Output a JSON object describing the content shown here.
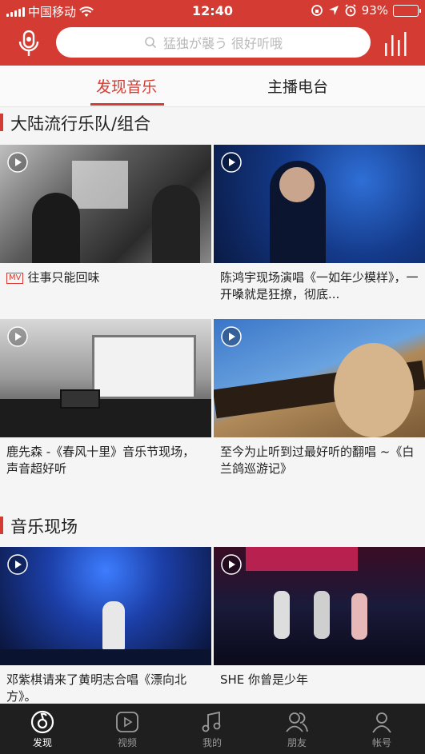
{
  "status_bar": {
    "carrier": "中国移动",
    "time": "12:40",
    "battery": "93%",
    "battery_level": 0.93,
    "icons": [
      "signal-icon",
      "wifi-icon",
      "lock-rotation-icon",
      "location-icon",
      "alarm-icon",
      "battery-icon"
    ]
  },
  "header": {
    "search_placeholder": "猛独が襲う 很好听哦",
    "left_icon": "microphone-icon",
    "right_icon": "equalizer-icon"
  },
  "tabs": [
    {
      "label": "发现音乐",
      "active": true
    },
    {
      "label": "主播电台",
      "active": false
    }
  ],
  "sections": [
    {
      "title": "大陆流行乐队/组合",
      "items": [
        {
          "title": "往事只能回味",
          "badge": "MV"
        },
        {
          "title": "陈鸿宇现场演唱《一如年少模样》，一开嗓就是狂撩，彻底...",
          "badge": ""
        },
        {
          "title": "鹿先森 -《春风十里》音乐节现场，声音超好听",
          "badge": ""
        },
        {
          "title": "至今为止听到过最好听的翻唱 ~《白兰鸽巡游记》",
          "badge": ""
        }
      ]
    },
    {
      "title": "音乐现场",
      "items": [
        {
          "title": "邓紫棋请来了黄明志合唱《漂向北方》。",
          "badge": ""
        },
        {
          "title": "SHE 你曾是少年",
          "badge": ""
        }
      ]
    }
  ],
  "bottom_nav": [
    {
      "label": "发现",
      "icon": "netease-music-icon",
      "active": true
    },
    {
      "label": "视频",
      "icon": "video-play-icon",
      "active": false
    },
    {
      "label": "我的",
      "icon": "music-note-icon",
      "active": false
    },
    {
      "label": "朋友",
      "icon": "friends-icon",
      "active": false
    },
    {
      "label": "帐号",
      "icon": "account-icon",
      "active": false
    }
  ],
  "colors": {
    "brand": "#d43c33",
    "battery": "#f7c21a",
    "nav_bg": "#1f1f1f"
  }
}
